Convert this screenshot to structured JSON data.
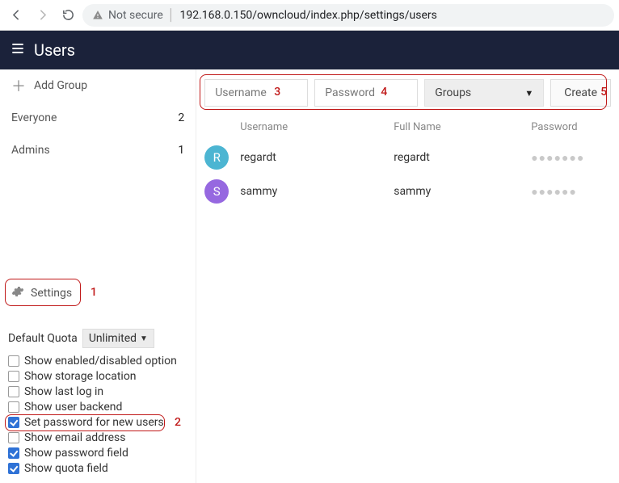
{
  "browser": {
    "not_secure": "Not secure",
    "url": "192.168.0.150/owncloud/index.php/settings/users"
  },
  "header": {
    "title": "Users"
  },
  "sidebar": {
    "add_group": "Add Group",
    "groups": [
      {
        "label": "Everyone",
        "count": "2"
      },
      {
        "label": "Admins",
        "count": "1"
      }
    ],
    "settings_label": "Settings",
    "quota_label": "Default Quota",
    "quota_value": "Unlimited",
    "options": [
      {
        "label": "Show enabled/disabled option",
        "checked": false
      },
      {
        "label": "Show storage location",
        "checked": false
      },
      {
        "label": "Show last log in",
        "checked": false
      },
      {
        "label": "Show user backend",
        "checked": false
      },
      {
        "label": "Set password for new users",
        "checked": true
      },
      {
        "label": "Show email address",
        "checked": false
      },
      {
        "label": "Show password field",
        "checked": true
      },
      {
        "label": "Show quota field",
        "checked": true
      }
    ]
  },
  "toolbar": {
    "username_ph": "Username",
    "password_ph": "Password",
    "groups_label": "Groups",
    "create_label": "Create"
  },
  "table": {
    "cols": {
      "username": "Username",
      "fullname": "Full Name",
      "password": "Password"
    },
    "rows": [
      {
        "initial": "R",
        "color": "#4cb5d2",
        "username": "regardt",
        "fullname": "regardt",
        "pw": "●●●●●●●"
      },
      {
        "initial": "S",
        "color": "#9668e0",
        "username": "sammy",
        "fullname": "sammy",
        "pw": "●●●●●●"
      }
    ]
  },
  "annotations": {
    "n1": "1",
    "n2": "2",
    "n3": "3",
    "n4": "4",
    "n5": "5"
  }
}
